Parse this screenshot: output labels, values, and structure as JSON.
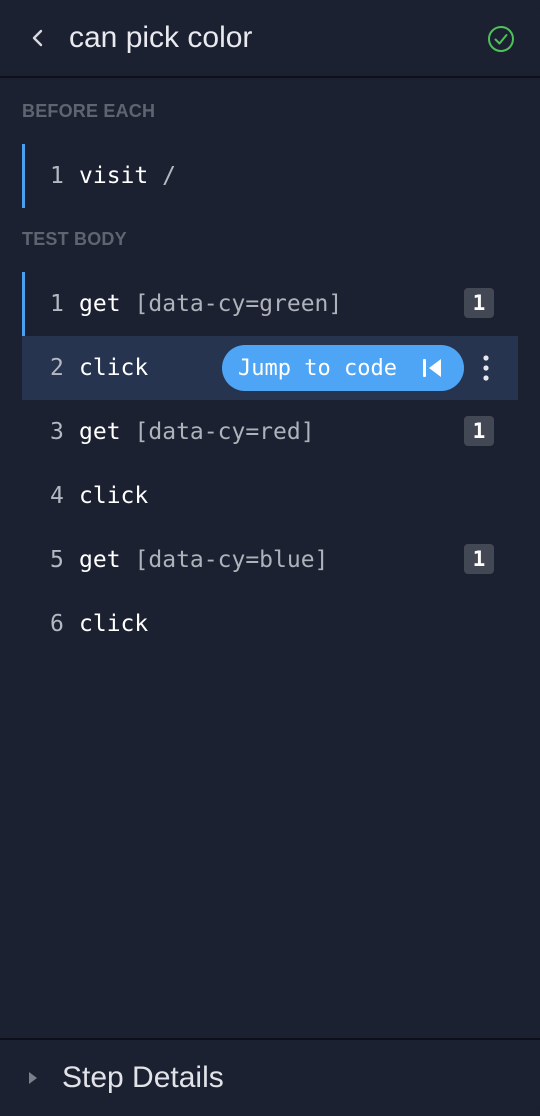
{
  "header": {
    "title": "can pick color",
    "back_icon": "chevron-left-icon",
    "status_icon": "check-circle-icon",
    "status_color": "#4fc15a"
  },
  "before_each": {
    "label": "BEFORE EACH",
    "steps": [
      {
        "num": "1",
        "cmd": "visit",
        "arg": "/"
      }
    ]
  },
  "test_body": {
    "label": "TEST BODY",
    "steps": [
      {
        "num": "1",
        "cmd": "get",
        "arg": "[data-cy=green]",
        "badge": "1"
      },
      {
        "num": "2",
        "cmd": "click",
        "jump_label": "Jump to code",
        "jump_icon": "jump-to-code-icon",
        "more_icon": "more-vertical-icon"
      },
      {
        "num": "3",
        "cmd": "get",
        "arg": "[data-cy=red]",
        "badge": "1"
      },
      {
        "num": "4",
        "cmd": "click"
      },
      {
        "num": "5",
        "cmd": "get",
        "arg": "[data-cy=blue]",
        "badge": "1"
      },
      {
        "num": "6",
        "cmd": "click"
      }
    ]
  },
  "footer": {
    "label": "Step Details",
    "caret_icon": "caret-right-icon"
  },
  "colors": {
    "accent": "#4fa5f5",
    "group_bar": "#4a9ff0",
    "background": "#1b2130",
    "active_row": "#263450"
  }
}
